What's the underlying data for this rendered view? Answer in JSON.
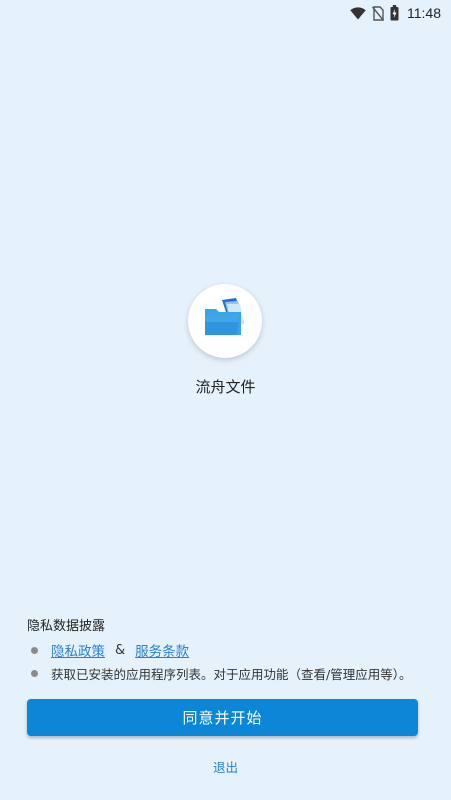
{
  "status_bar": {
    "time": "11:48",
    "icons": [
      "wifi-icon",
      "no-sim-icon",
      "battery-charging-icon"
    ]
  },
  "app": {
    "name": "流舟文件",
    "logo_icon": "folder-files-icon"
  },
  "privacy": {
    "title": "隐私数据披露",
    "privacy_policy_link": "隐私政策",
    "ampersand": "&",
    "terms_link": "服务条款",
    "app_list_notice": "获取已安装的应用程序列表。对于应用功能（查看/管理应用等）。"
  },
  "actions": {
    "agree_label": "同意并开始",
    "exit_label": "退出"
  },
  "colors": {
    "background": "#e6f2fb",
    "primary": "#0c86d6",
    "link": "#2a7fd0"
  }
}
